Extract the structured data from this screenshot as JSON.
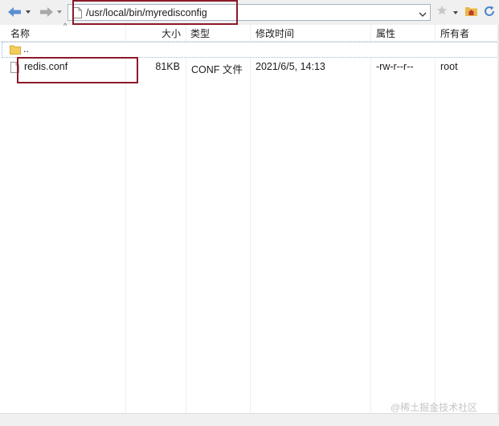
{
  "address": {
    "path": "/usr/local/bin/myredisconfig"
  },
  "columns": {
    "name": "名称",
    "size": "大小",
    "type": "类型",
    "modified": "修改时间",
    "attributes": "属性",
    "owner": "所有者"
  },
  "parent_row": {
    "name": ".."
  },
  "files": [
    {
      "name": "redis.conf",
      "size": "81KB",
      "type": "CONF 文件",
      "modified": "2021/6/5, 14:13",
      "attributes": "-rw-r--r--",
      "owner": "root"
    }
  ],
  "watermark": "@稀土掘金技术社区",
  "colors": {
    "highlight": "#8b1a2a",
    "nav_arrow": "#5a8fd0",
    "folder": "#f2cd5c"
  },
  "icons": [
    "back-arrow-icon",
    "forward-arrow-icon",
    "file-icon",
    "star-icon",
    "home-folder-icon",
    "refresh-icon",
    "folder-icon"
  ]
}
